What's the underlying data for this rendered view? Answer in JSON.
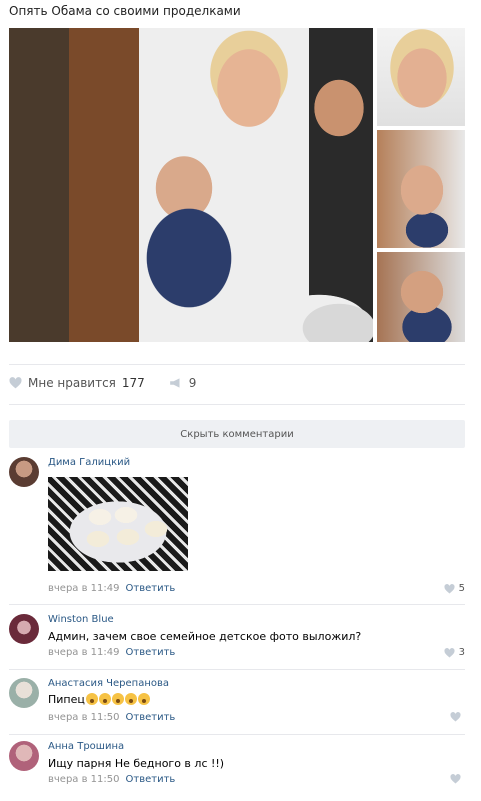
{
  "post": {
    "title": "Опять Обама со своими проделками"
  },
  "actions": {
    "like_label": "Мне нравится",
    "like_count": "177",
    "share_count": "9"
  },
  "hide_comments_label": "Скрыть комментарии",
  "comments": [
    {
      "author": "Дима Галицкий",
      "text": "",
      "time": "вчера в 11:49",
      "reply": "Ответить",
      "likes": "5",
      "avatar_color": "#7a5a4a",
      "has_photo": true
    },
    {
      "author": "Winston Blue",
      "text": "Админ, зачем свое семейное детское фото выложил?",
      "time": "вчера в 11:49",
      "reply": "Ответить",
      "likes": "3",
      "avatar_color": "#8a3a4a"
    },
    {
      "author": "Анастасия Черепанова",
      "text": "Пипец",
      "time": "вчера в 11:50",
      "reply": "Ответить",
      "likes": "",
      "avatar_color": "#9ab0a8"
    },
    {
      "author": "Анна Трошина",
      "text": "Ищу парня Не бедного в лс !!)",
      "time": "вчера в 11:50",
      "reply": "Ответить",
      "likes": "",
      "avatar_color": "#b0627a"
    }
  ],
  "colors": {
    "link": "#2a5885",
    "muted": "#939393",
    "button_bg": "#eef0f3"
  }
}
